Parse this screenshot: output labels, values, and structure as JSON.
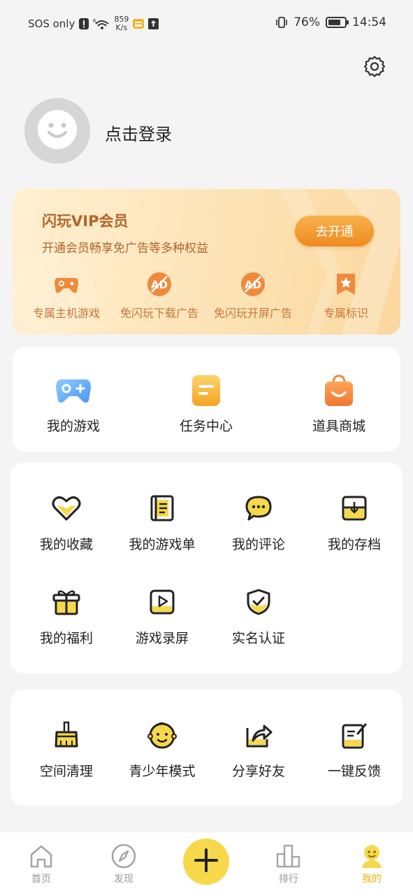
{
  "status_bar": {
    "carrier": "SOS only",
    "net_speed_value": "859",
    "net_speed_unit": "K/s",
    "battery": "76%",
    "battery_level": 0.76,
    "time": "14:54"
  },
  "profile": {
    "login_label": "点击登录"
  },
  "vip": {
    "title": "闪玩VIP会员",
    "subtitle": "开通会员畅享免广告等多种权益",
    "open_button": "去开通",
    "perks": [
      {
        "label": "专属主机游戏",
        "icon": "gamepad-icon"
      },
      {
        "label": "免闪玩下载广告",
        "icon": "no-ad-icon"
      },
      {
        "label": "免闪玩开屏广告",
        "icon": "no-ad-icon"
      },
      {
        "label": "专属标识",
        "icon": "badge-star-icon"
      }
    ],
    "accent_color": "#b2652b",
    "button_color": "#ef8a21"
  },
  "quick": [
    {
      "label": "我的游戏",
      "icon": "gamepad-icon"
    },
    {
      "label": "任务中心",
      "icon": "task-icon"
    },
    {
      "label": "道具商城",
      "icon": "shopping-bag-icon"
    }
  ],
  "tools": [
    {
      "label": "我的收藏",
      "icon": "heart-icon"
    },
    {
      "label": "我的游戏单",
      "icon": "list-book-icon"
    },
    {
      "label": "我的评论",
      "icon": "comment-icon"
    },
    {
      "label": "我的存档",
      "icon": "archive-icon"
    },
    {
      "label": "我的福利",
      "icon": "gift-icon"
    },
    {
      "label": "游戏录屏",
      "icon": "play-record-icon"
    },
    {
      "label": "实名认证",
      "icon": "shield-check-icon"
    }
  ],
  "more": [
    {
      "label": "空间清理",
      "icon": "broom-icon"
    },
    {
      "label": "青少年模式",
      "icon": "child-face-icon"
    },
    {
      "label": "分享好友",
      "icon": "share-icon"
    },
    {
      "label": "一键反馈",
      "icon": "feedback-icon"
    }
  ],
  "nav": [
    {
      "label": "首页",
      "icon": "home-icon"
    },
    {
      "label": "发现",
      "icon": "compass-icon"
    },
    {
      "label": "排行",
      "icon": "rank-chart-icon"
    },
    {
      "label": "我的",
      "icon": "profile-icon",
      "active": true
    }
  ],
  "colors": {
    "brand_yellow": "#f7d84a",
    "active_nav": "#f2b500"
  }
}
